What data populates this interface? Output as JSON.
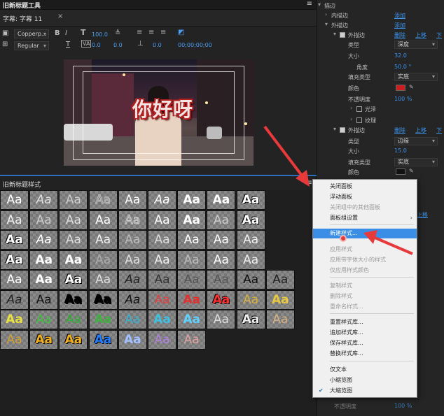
{
  "title_panel": {
    "header": "旧新标题工具",
    "caption_label": "字幕: 字幕 11",
    "close_glyph": "×",
    "font_family": "Copperp...",
    "font_style": "Regular",
    "font_size": "100.0",
    "kerning": "0.0",
    "leading": "0.0",
    "tab_stops": "0.0",
    "timecode": "00;00;00;00"
  },
  "preview": {
    "title_text": "你好呀"
  },
  "properties": {
    "rows": [
      {
        "label": "描边",
        "type": "section"
      },
      {
        "label": "内描边",
        "link": "添加"
      },
      {
        "label": "外描边",
        "link": "添加"
      },
      {
        "label": "外描边",
        "checked": true,
        "links": [
          "删除",
          "上移",
          "下"
        ]
      },
      {
        "label": "类型",
        "select": "深度"
      },
      {
        "label": "大小",
        "value": "32.0"
      },
      {
        "label": "角度",
        "value": "50.0 °"
      },
      {
        "label": "填充类型",
        "select": "实底"
      },
      {
        "label": "颜色",
        "swatch": "#cc1f1f"
      },
      {
        "label": "不透明度",
        "value": "100 %"
      },
      {
        "label": "光泽"
      },
      {
        "label": "纹理"
      },
      {
        "label": "外描边",
        "checked": true,
        "links": [
          "删除",
          "上移",
          "下"
        ]
      },
      {
        "label": "类型",
        "select": "边缘"
      },
      {
        "label": "大小",
        "value": "15.0"
      },
      {
        "label": "填充类型",
        "select": "实底"
      },
      {
        "label": "颜色",
        "swatch": "#111111"
      }
    ],
    "side_link": "上移",
    "bottom_label": "不透明度",
    "bottom_value": "100 %"
  },
  "styles_panel": {
    "header": "旧新标题样式",
    "cell_text": "Aa"
  },
  "context_menu": {
    "items": [
      {
        "label": "关闭面板",
        "disabled": false
      },
      {
        "label": "浮动面板",
        "disabled": false
      },
      {
        "label": "关闭组中的其他面板",
        "disabled": true
      },
      {
        "label": "面板组设置",
        "disabled": false,
        "submenu": true
      },
      {
        "label": "新建样式...",
        "disabled": false,
        "highlighted": true
      },
      {
        "label": "应用样式",
        "disabled": true
      },
      {
        "label": "应用带字体大小的样式",
        "disabled": true
      },
      {
        "label": "仅应用样式颜色",
        "disabled": true
      },
      {
        "label": "复制样式",
        "disabled": true
      },
      {
        "label": "删除样式",
        "disabled": true
      },
      {
        "label": "重命名样式...",
        "disabled": true
      },
      {
        "label": "重置样式库...",
        "disabled": false
      },
      {
        "label": "追加样式库...",
        "disabled": false
      },
      {
        "label": "保存样式库...",
        "disabled": false
      },
      {
        "label": "替换样式库...",
        "disabled": false
      },
      {
        "label": "仅文本",
        "disabled": false
      },
      {
        "label": "小缩览图",
        "disabled": false
      },
      {
        "label": "大缩览图",
        "disabled": false,
        "checked": true
      }
    ],
    "submenu_glyph": "›",
    "check_glyph": "✔"
  },
  "colors": {
    "accent": "#3a8ee6",
    "link": "#3b93f0",
    "arrow": "#e83a3a"
  }
}
